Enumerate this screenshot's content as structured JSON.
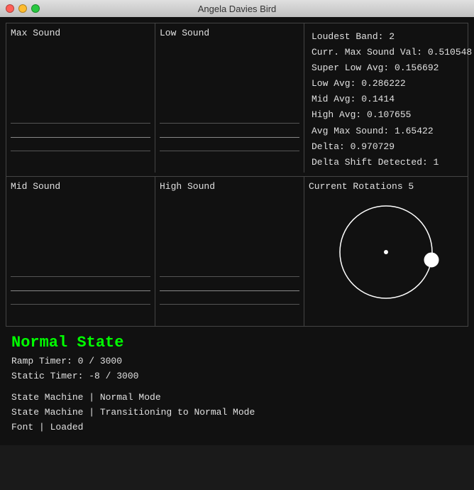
{
  "titleBar": {
    "title": "Angela Davies Bird",
    "controls": {
      "close": "close",
      "minimize": "minimize",
      "maximize": "maximize"
    }
  },
  "panels": {
    "maxSound": "Max Sound",
    "lowSound": "Low Sound",
    "midSound": "Mid Sound",
    "highSound": "High Sound"
  },
  "info": {
    "loudestBand": "Loudest Band: 2",
    "currMaxSoundVal": "Curr. Max Sound Val: 0.510548",
    "superLowAvg": "Super Low Avg: 0.156692",
    "lowAvg": "Low Avg: 0.286222",
    "midAvg": "Mid Avg: 0.1414",
    "highAvg": "High Avg: 0.107655",
    "avgMaxSound": "Avg Max Sound: 1.65422",
    "delta": "Delta: 0.970729",
    "deltaShift": "Delta Shift Detected: 1"
  },
  "rotation": {
    "label": "Current Rotations 5"
  },
  "status": {
    "normalState": "Normal State",
    "rampTimer": "Ramp Timer: 0 / 3000",
    "staticTimer": "Static Timer: -8 / 3000",
    "stateMachine1": "State Machine | Normal Mode",
    "stateMachine2": "State Machine | Transitioning to Normal Mode",
    "font": "Font | Loaded"
  },
  "colors": {
    "green": "#00ff00",
    "text": "#e0e0e0",
    "bg": "#111111",
    "border": "#444444"
  }
}
